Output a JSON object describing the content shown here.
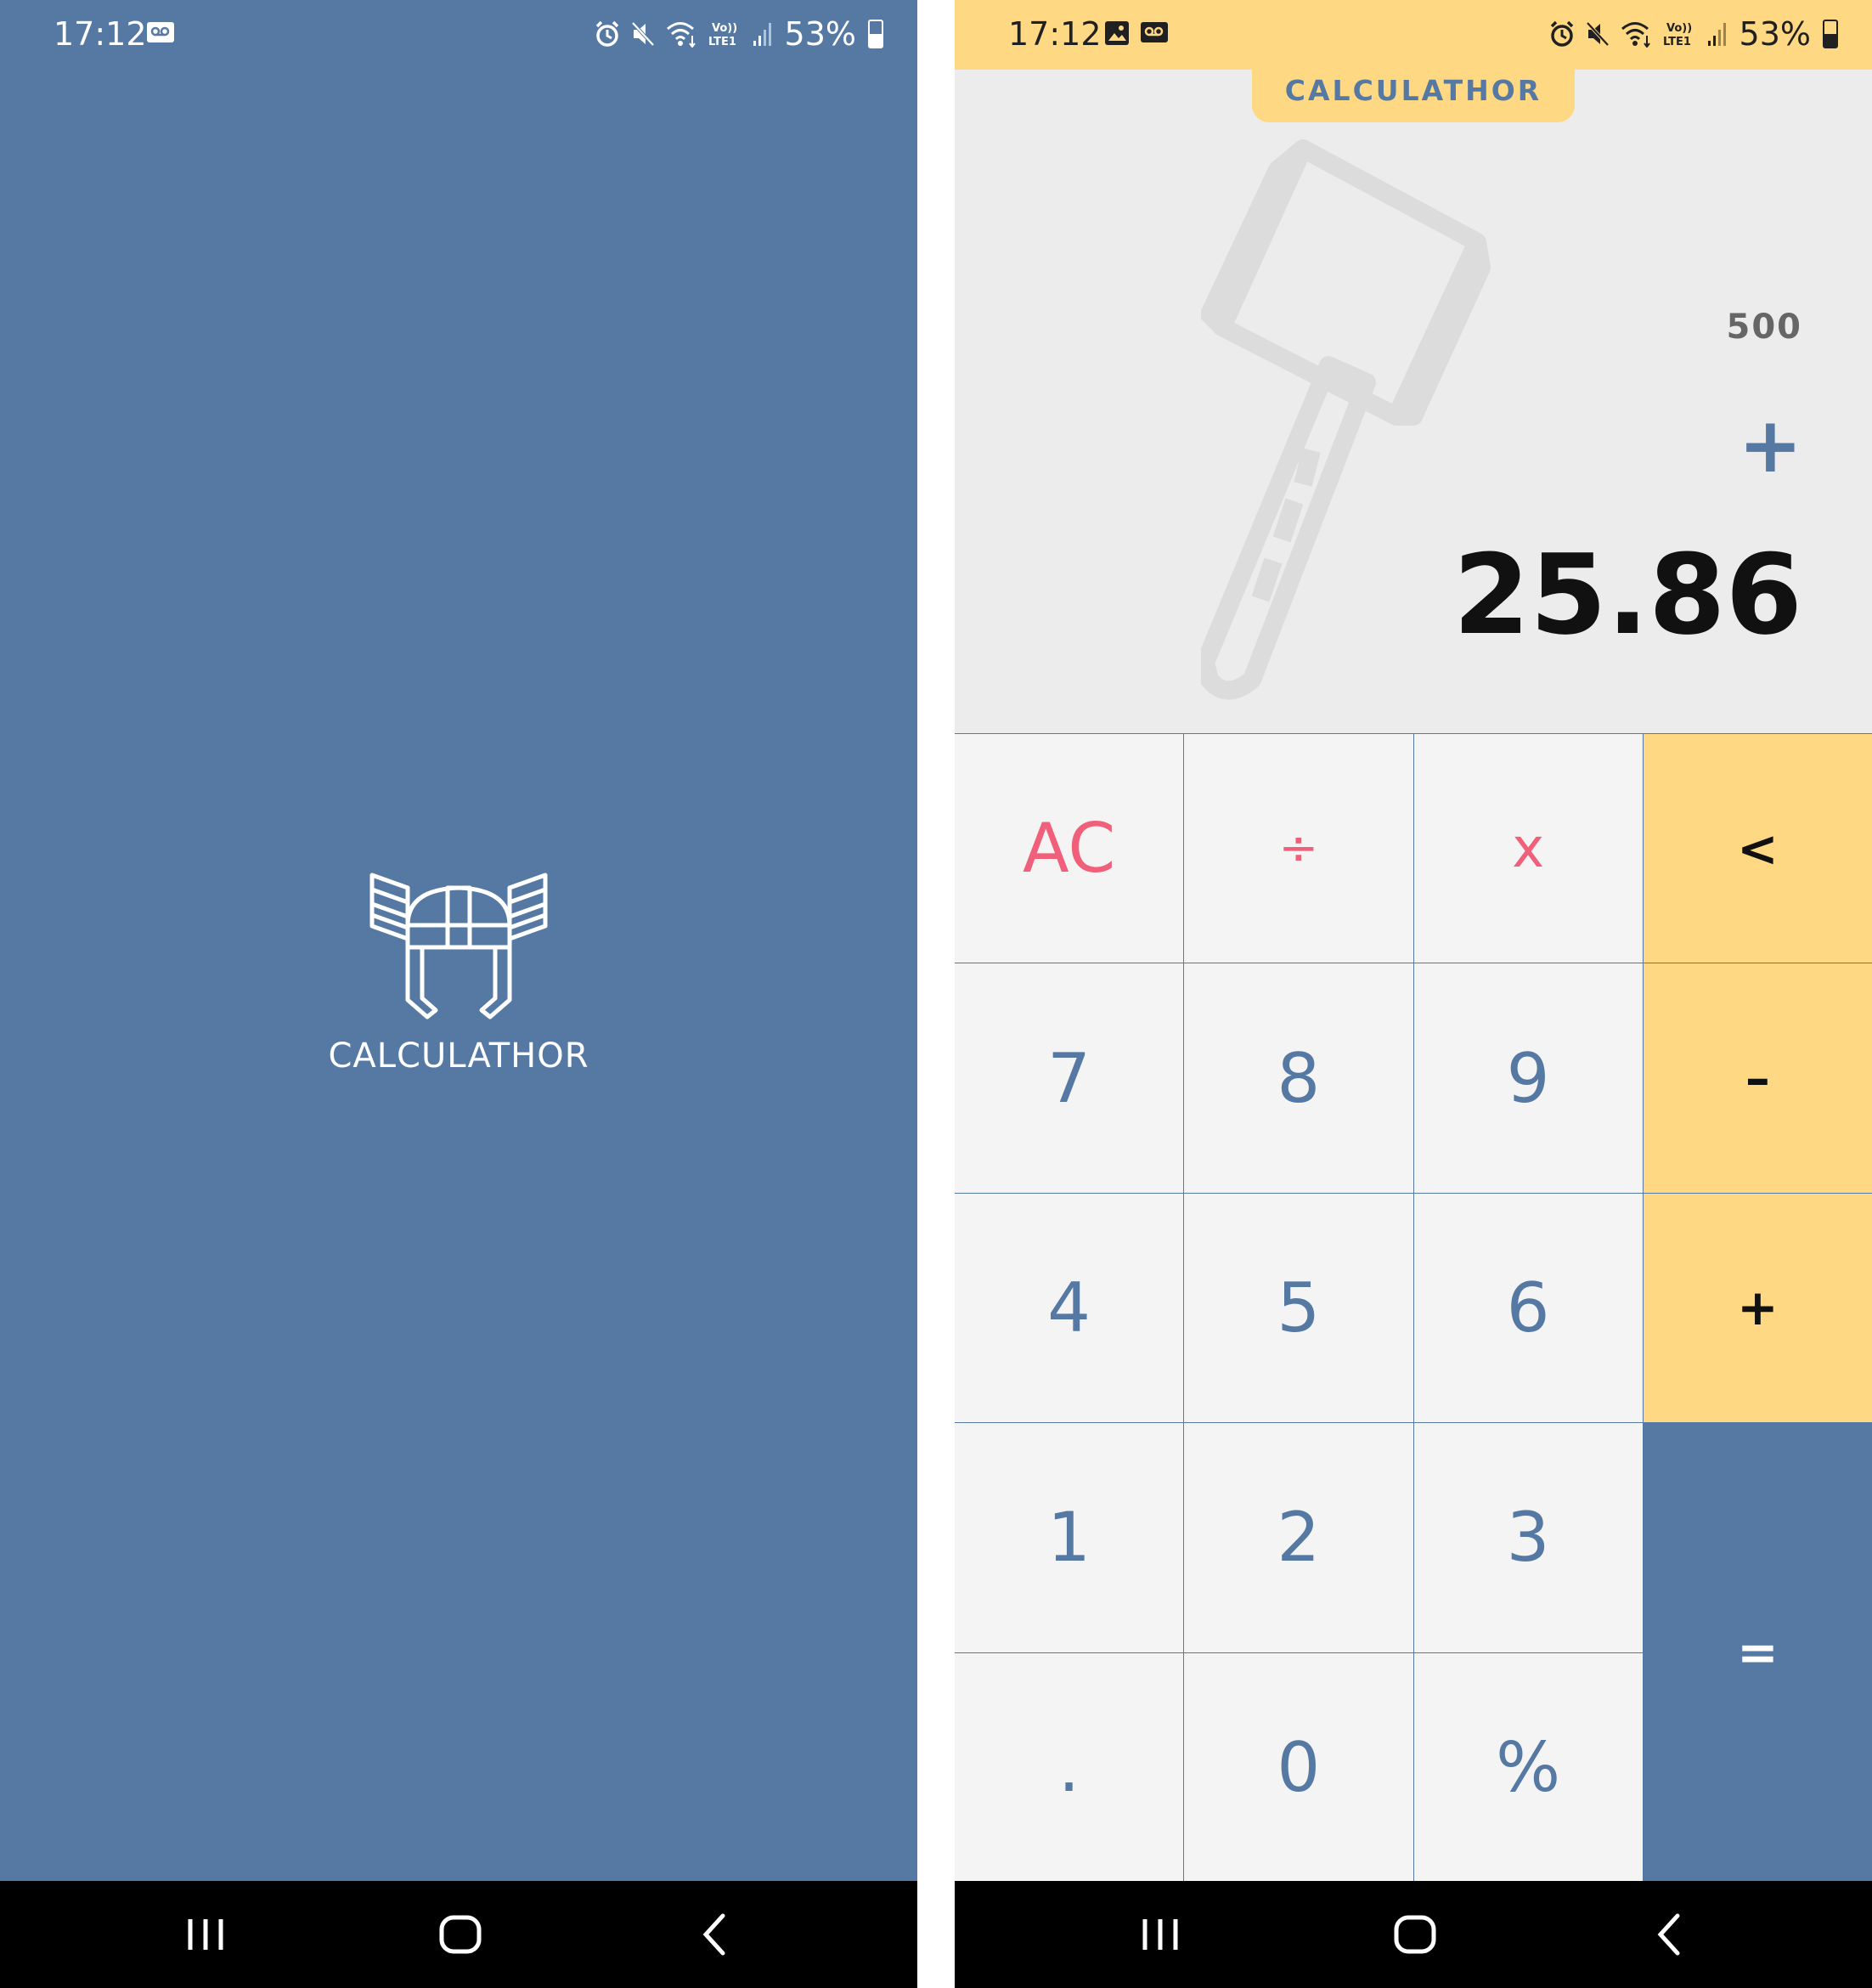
{
  "splash": {
    "status": {
      "time": "17:12",
      "battery": "53%"
    },
    "title": "CALCULATHOR"
  },
  "calculator": {
    "status": {
      "time": "17:12",
      "battery": "53%"
    },
    "app_title": "CALCULATHOR",
    "display": {
      "previous": "500",
      "operator": "+",
      "current": "25.86"
    },
    "keys": [
      "AC",
      "÷",
      "x",
      "<",
      "7",
      "8",
      "9",
      "–",
      "4",
      "5",
      "6",
      "+",
      "1",
      "2",
      "3",
      "=",
      ".",
      "0",
      "%"
    ]
  },
  "colors": {
    "primary_blue": "#5679a3",
    "accent_yellow": "#ffd883",
    "danger_pink": "#f0607a"
  }
}
